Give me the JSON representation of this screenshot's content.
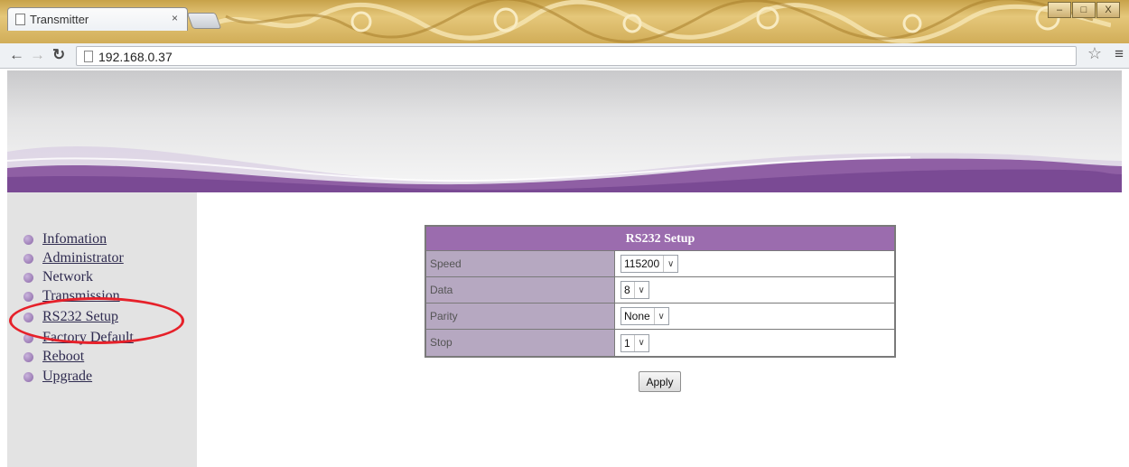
{
  "browser": {
    "tab_title": "Transmitter",
    "tab_close": "×",
    "url": "192.168.0.37",
    "window_buttons": [
      "–",
      "□",
      "X"
    ]
  },
  "sidebar": {
    "items": [
      {
        "label": "Infomation"
      },
      {
        "label": "Administrator"
      },
      {
        "label": "Network"
      },
      {
        "label": "Transmission"
      },
      {
        "label": "RS232 Setup"
      },
      {
        "label": "Factory Default"
      },
      {
        "label": "Reboot"
      },
      {
        "label": "Upgrade"
      }
    ]
  },
  "form": {
    "title": "RS232 Setup",
    "rows": [
      {
        "label": "Speed",
        "value": "115200"
      },
      {
        "label": "Data",
        "value": "8"
      },
      {
        "label": "Parity",
        "value": "None"
      },
      {
        "label": "Stop",
        "value": "1"
      }
    ],
    "apply_label": "Apply"
  },
  "colors": {
    "accent_purple": "#9b6cae",
    "label_cell": "#b6a8c1",
    "highlight_ring": "#e6212a"
  }
}
